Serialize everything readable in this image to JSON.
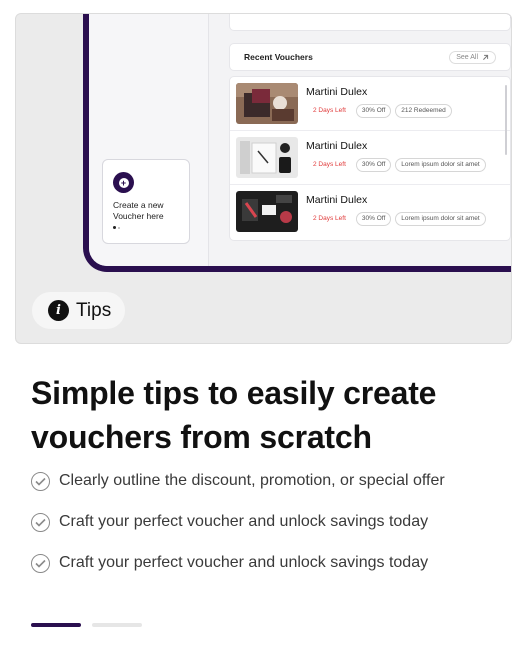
{
  "hero": {
    "create_card": {
      "label": "Create a new Voucher here"
    },
    "recent": {
      "title": "Recent Vouchers",
      "see_all": "See All"
    },
    "vouchers": [
      {
        "name": "Martini Dulex",
        "expiry": "2 Days Left",
        "discount": "30% Off",
        "extra": "212 Redeemed"
      },
      {
        "name": "Martini Dulex",
        "expiry": "2 Days Left",
        "discount": "30% Off",
        "extra": "Lorem ipsum dolor sit amet"
      },
      {
        "name": "Martini Dulex",
        "expiry": "2 Days Left",
        "discount": "30% Off",
        "extra": "Lorem ipsum dolor sit amet"
      }
    ]
  },
  "tips": {
    "label": "Tips",
    "icon": "info-icon"
  },
  "headline": "Simple tips to easily create vouchers from scratch",
  "bullets": [
    "Clearly outline the discount, promotion, or special offer",
    "Craft your perfect voucher and unlock savings today",
    "Craft your perfect voucher and unlock savings today"
  ],
  "pager": {
    "count": 2,
    "active": 1
  },
  "colors": {
    "accent": "#2a0f4f",
    "expiry": "#e03a3a"
  }
}
